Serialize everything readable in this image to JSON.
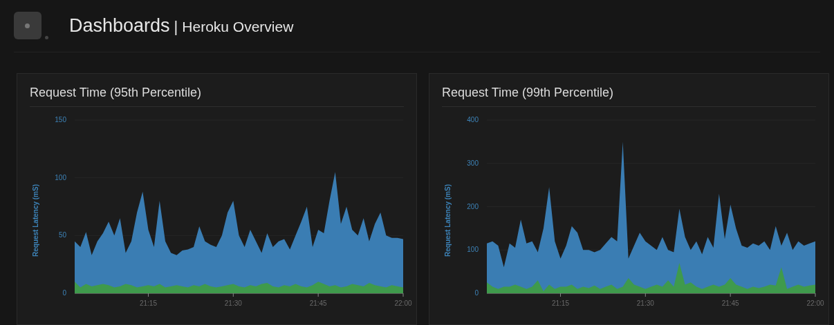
{
  "header": {
    "title": "Dashboards",
    "separator": "|",
    "subtitle": "Heroku Overview"
  },
  "panels": [
    {
      "title": "Request Time (95th Percentile)",
      "chart_data": {
        "type": "area",
        "grid": true,
        "ylabel": "Request Latency (mS)",
        "stacked": false,
        "ylim": [
          0,
          150
        ],
        "yticks": [
          0,
          50,
          100,
          150
        ],
        "categories": [
          null,
          null,
          null,
          null,
          null,
          null,
          null,
          null,
          null,
          null,
          null,
          null,
          null,
          "21:15",
          null,
          null,
          null,
          null,
          null,
          null,
          null,
          null,
          null,
          null,
          null,
          null,
          null,
          null,
          "21:30",
          null,
          null,
          null,
          null,
          null,
          null,
          null,
          null,
          null,
          null,
          null,
          null,
          null,
          null,
          "21:45",
          null,
          null,
          null,
          null,
          null,
          null,
          null,
          null,
          null,
          null,
          null,
          null,
          null,
          null,
          "22:00"
        ],
        "series": [
          {
            "color": "#3a7db3",
            "values": [
              45,
              40,
              53,
              33,
              45,
              52,
              62,
              50,
              65,
              35,
              45,
              70,
              88,
              55,
              40,
              80,
              45,
              35,
              33,
              37,
              38,
              40,
              58,
              45,
              42,
              40,
              50,
              70,
              80,
              50,
              40,
              55,
              45,
              35,
              52,
              40,
              45,
              47,
              38,
              50,
              62,
              75,
              40,
              55,
              52,
              80,
              105,
              60,
              75,
              55,
              50,
              65,
              45,
              60,
              70,
              50,
              48,
              48,
              47
            ]
          },
          {
            "color": "#3f9a4c",
            "values": [
              10,
              5,
              8,
              6,
              7,
              8,
              7,
              5,
              6,
              8,
              7,
              5,
              6,
              7,
              6,
              8,
              5,
              6,
              7,
              6,
              5,
              7,
              6,
              8,
              6,
              5,
              6,
              7,
              8,
              6,
              5,
              7,
              6,
              8,
              9,
              6,
              5,
              7,
              6,
              8,
              6,
              5,
              7,
              10,
              8,
              6,
              7,
              5,
              6,
              8,
              7,
              6,
              9,
              7,
              6,
              5,
              7,
              6,
              5
            ]
          }
        ]
      }
    },
    {
      "title": "Request Time (99th Percentile)",
      "chart_data": {
        "type": "area",
        "grid": true,
        "ylabel": "Request Latency (mS)",
        "stacked": false,
        "ylim": [
          0,
          400
        ],
        "yticks": [
          0,
          100,
          200,
          300,
          400
        ],
        "categories": [
          null,
          null,
          null,
          null,
          null,
          null,
          null,
          null,
          null,
          null,
          null,
          null,
          null,
          "21:15",
          null,
          null,
          null,
          null,
          null,
          null,
          null,
          null,
          null,
          null,
          null,
          null,
          null,
          null,
          "21:30",
          null,
          null,
          null,
          null,
          null,
          null,
          null,
          null,
          null,
          null,
          null,
          null,
          null,
          null,
          "21:45",
          null,
          null,
          null,
          null,
          null,
          null,
          null,
          null,
          null,
          null,
          null,
          null,
          null,
          null,
          "22:00"
        ],
        "series": [
          {
            "color": "#3a7db3",
            "values": [
              115,
              120,
              110,
              60,
              115,
              105,
              170,
              115,
              120,
              95,
              150,
              245,
              120,
              80,
              110,
              155,
              140,
              100,
              100,
              95,
              100,
              115,
              130,
              120,
              350,
              80,
              110,
              140,
              120,
              110,
              100,
              130,
              100,
              95,
              195,
              130,
              100,
              120,
              90,
              130,
              105,
              230,
              125,
              205,
              150,
              110,
              105,
              115,
              110,
              120,
              100,
              155,
              110,
              140,
              100,
              120,
              110,
              115,
              120
            ]
          },
          {
            "color": "#3f9a4c",
            "values": [
              25,
              15,
              10,
              15,
              15,
              20,
              15,
              10,
              15,
              30,
              5,
              20,
              10,
              15,
              15,
              20,
              10,
              15,
              12,
              18,
              10,
              15,
              20,
              10,
              15,
              35,
              20,
              15,
              10,
              15,
              20,
              15,
              30,
              15,
              70,
              20,
              25,
              15,
              10,
              15,
              20,
              15,
              20,
              35,
              20,
              15,
              10,
              15,
              12,
              15,
              20,
              18,
              60,
              10,
              15,
              20,
              15,
              18,
              20
            ]
          }
        ]
      }
    }
  ]
}
